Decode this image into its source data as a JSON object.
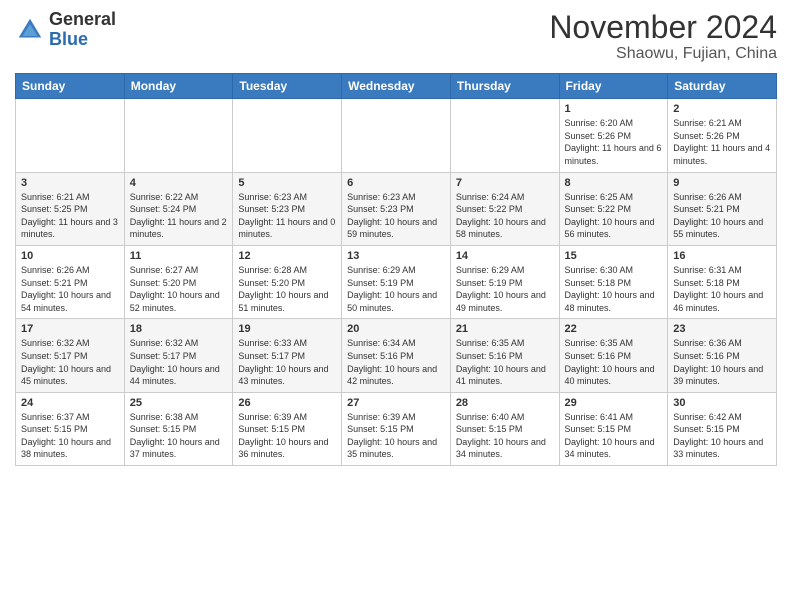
{
  "header": {
    "logo_general": "General",
    "logo_blue": "Blue",
    "month_title": "November 2024",
    "location": "Shaowu, Fujian, China"
  },
  "days_of_week": [
    "Sunday",
    "Monday",
    "Tuesday",
    "Wednesday",
    "Thursday",
    "Friday",
    "Saturday"
  ],
  "weeks": [
    {
      "row_bg": "white",
      "days": [
        {
          "num": "",
          "info": ""
        },
        {
          "num": "",
          "info": ""
        },
        {
          "num": "",
          "info": ""
        },
        {
          "num": "",
          "info": ""
        },
        {
          "num": "",
          "info": ""
        },
        {
          "num": "1",
          "info": "Sunrise: 6:20 AM\nSunset: 5:26 PM\nDaylight: 11 hours and 6 minutes."
        },
        {
          "num": "2",
          "info": "Sunrise: 6:21 AM\nSunset: 5:26 PM\nDaylight: 11 hours and 4 minutes."
        }
      ]
    },
    {
      "row_bg": "gray",
      "days": [
        {
          "num": "3",
          "info": "Sunrise: 6:21 AM\nSunset: 5:25 PM\nDaylight: 11 hours and 3 minutes."
        },
        {
          "num": "4",
          "info": "Sunrise: 6:22 AM\nSunset: 5:24 PM\nDaylight: 11 hours and 2 minutes."
        },
        {
          "num": "5",
          "info": "Sunrise: 6:23 AM\nSunset: 5:23 PM\nDaylight: 11 hours and 0 minutes."
        },
        {
          "num": "6",
          "info": "Sunrise: 6:23 AM\nSunset: 5:23 PM\nDaylight: 10 hours and 59 minutes."
        },
        {
          "num": "7",
          "info": "Sunrise: 6:24 AM\nSunset: 5:22 PM\nDaylight: 10 hours and 58 minutes."
        },
        {
          "num": "8",
          "info": "Sunrise: 6:25 AM\nSunset: 5:22 PM\nDaylight: 10 hours and 56 minutes."
        },
        {
          "num": "9",
          "info": "Sunrise: 6:26 AM\nSunset: 5:21 PM\nDaylight: 10 hours and 55 minutes."
        }
      ]
    },
    {
      "row_bg": "white",
      "days": [
        {
          "num": "10",
          "info": "Sunrise: 6:26 AM\nSunset: 5:21 PM\nDaylight: 10 hours and 54 minutes."
        },
        {
          "num": "11",
          "info": "Sunrise: 6:27 AM\nSunset: 5:20 PM\nDaylight: 10 hours and 52 minutes."
        },
        {
          "num": "12",
          "info": "Sunrise: 6:28 AM\nSunset: 5:20 PM\nDaylight: 10 hours and 51 minutes."
        },
        {
          "num": "13",
          "info": "Sunrise: 6:29 AM\nSunset: 5:19 PM\nDaylight: 10 hours and 50 minutes."
        },
        {
          "num": "14",
          "info": "Sunrise: 6:29 AM\nSunset: 5:19 PM\nDaylight: 10 hours and 49 minutes."
        },
        {
          "num": "15",
          "info": "Sunrise: 6:30 AM\nSunset: 5:18 PM\nDaylight: 10 hours and 48 minutes."
        },
        {
          "num": "16",
          "info": "Sunrise: 6:31 AM\nSunset: 5:18 PM\nDaylight: 10 hours and 46 minutes."
        }
      ]
    },
    {
      "row_bg": "gray",
      "days": [
        {
          "num": "17",
          "info": "Sunrise: 6:32 AM\nSunset: 5:17 PM\nDaylight: 10 hours and 45 minutes."
        },
        {
          "num": "18",
          "info": "Sunrise: 6:32 AM\nSunset: 5:17 PM\nDaylight: 10 hours and 44 minutes."
        },
        {
          "num": "19",
          "info": "Sunrise: 6:33 AM\nSunset: 5:17 PM\nDaylight: 10 hours and 43 minutes."
        },
        {
          "num": "20",
          "info": "Sunrise: 6:34 AM\nSunset: 5:16 PM\nDaylight: 10 hours and 42 minutes."
        },
        {
          "num": "21",
          "info": "Sunrise: 6:35 AM\nSunset: 5:16 PM\nDaylight: 10 hours and 41 minutes."
        },
        {
          "num": "22",
          "info": "Sunrise: 6:35 AM\nSunset: 5:16 PM\nDaylight: 10 hours and 40 minutes."
        },
        {
          "num": "23",
          "info": "Sunrise: 6:36 AM\nSunset: 5:16 PM\nDaylight: 10 hours and 39 minutes."
        }
      ]
    },
    {
      "row_bg": "white",
      "days": [
        {
          "num": "24",
          "info": "Sunrise: 6:37 AM\nSunset: 5:15 PM\nDaylight: 10 hours and 38 minutes."
        },
        {
          "num": "25",
          "info": "Sunrise: 6:38 AM\nSunset: 5:15 PM\nDaylight: 10 hours and 37 minutes."
        },
        {
          "num": "26",
          "info": "Sunrise: 6:39 AM\nSunset: 5:15 PM\nDaylight: 10 hours and 36 minutes."
        },
        {
          "num": "27",
          "info": "Sunrise: 6:39 AM\nSunset: 5:15 PM\nDaylight: 10 hours and 35 minutes."
        },
        {
          "num": "28",
          "info": "Sunrise: 6:40 AM\nSunset: 5:15 PM\nDaylight: 10 hours and 34 minutes."
        },
        {
          "num": "29",
          "info": "Sunrise: 6:41 AM\nSunset: 5:15 PM\nDaylight: 10 hours and 34 minutes."
        },
        {
          "num": "30",
          "info": "Sunrise: 6:42 AM\nSunset: 5:15 PM\nDaylight: 10 hours and 33 minutes."
        }
      ]
    }
  ]
}
